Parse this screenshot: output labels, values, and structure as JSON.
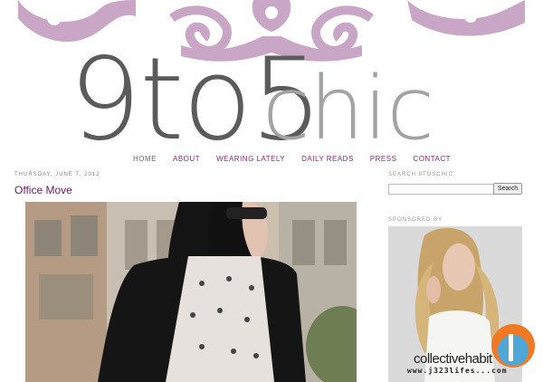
{
  "site": {
    "logo_dark": "9to5",
    "logo_light": "chic"
  },
  "nav": {
    "items": [
      {
        "label": "HOME"
      },
      {
        "label": "ABOUT"
      },
      {
        "label": "WEARING LATELY"
      },
      {
        "label": "DAILY READS"
      },
      {
        "label": "PRESS"
      },
      {
        "label": "CONTACT"
      }
    ]
  },
  "post": {
    "date": "THURSDAY, JUNE 7, 2012",
    "title": "Office Move"
  },
  "sidebar": {
    "search_heading": "SEARCH 9TOSCHIC",
    "search_button": "Search",
    "search_value": "",
    "sponsored_heading": "SPONSORED BY",
    "sponsor_brand": "collectivehabit"
  },
  "watermark": {
    "text": "www.j323lifes...com"
  },
  "colors": {
    "accent": "#8a2a73",
    "ornament": "#c9a6c6",
    "logo_dark": "#5b5b5b",
    "logo_light": "#a3a3a3"
  }
}
